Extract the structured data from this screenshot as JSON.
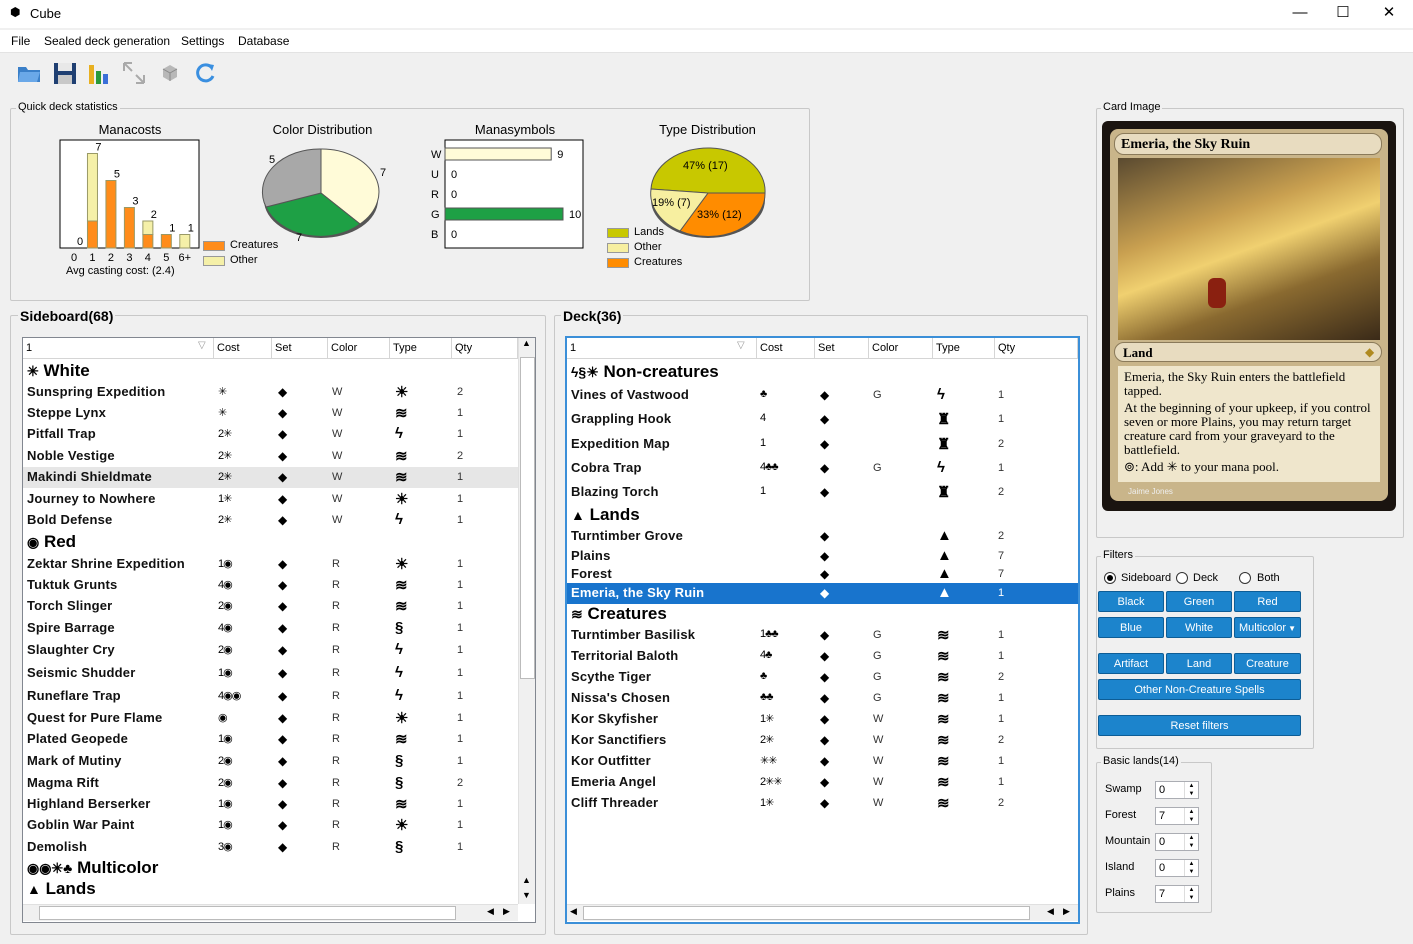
{
  "window": {
    "title": "Cube",
    "minimize": "—",
    "maximize": "☐",
    "close": "✕"
  },
  "menu": [
    "File",
    "Sealed deck generation",
    "Settings",
    "Database"
  ],
  "stats": {
    "group_label": "Quick deck statistics",
    "manacosts_title": "Manacosts",
    "color_title": "Color Distribution",
    "symbols_title": "Manasymbols",
    "type_title": "Type Distribution",
    "avg": "Avg casting cost: (2.4)",
    "legend_creatures": "Creatures",
    "legend_other": "Other",
    "type_legend": [
      "Lands",
      "Other",
      "Creatures"
    ],
    "pie_labels": {
      "color_left": "5",
      "color_right": "7",
      "color_bottom": "7"
    },
    "type_labels": [
      "47% (17)",
      "19% (7)",
      "33% (12)"
    ]
  },
  "chart_data": [
    {
      "type": "bar",
      "title": "Manacosts",
      "categories": [
        "0",
        "1",
        "2",
        "3",
        "4",
        "5",
        "6+"
      ],
      "series": [
        {
          "name": "Creatures",
          "values": [
            0,
            2,
            5,
            3,
            1,
            1,
            0
          ]
        },
        {
          "name": "Other",
          "values": [
            0,
            5,
            0,
            0,
            1,
            0,
            1
          ]
        }
      ],
      "totals": [
        0,
        7,
        5,
        3,
        2,
        1,
        1
      ],
      "ylim": [
        0,
        8
      ]
    },
    {
      "type": "pie",
      "title": "Color Distribution",
      "values": [
        5,
        7,
        7
      ],
      "colors": [
        "#a8a8a8",
        "#fffbd8",
        "#1ea045"
      ]
    },
    {
      "type": "bar",
      "title": "Manasymbols",
      "orientation": "horizontal",
      "categories": [
        "W",
        "U",
        "R",
        "G",
        "B"
      ],
      "values": [
        9,
        0,
        0,
        10,
        0
      ],
      "xlim": [
        0,
        10
      ]
    },
    {
      "type": "pie",
      "title": "Type Distribution",
      "values": [
        17,
        7,
        12
      ],
      "labels": [
        "Lands",
        "Other",
        "Creatures"
      ]
    }
  ],
  "sideboard": {
    "title": "Sideboard(68)",
    "headers": [
      "1",
      "Cost",
      "Set",
      "Color",
      "Type",
      "Qty"
    ],
    "groups": [
      "White",
      "Red",
      "Multicolor",
      "Lands"
    ],
    "rows": [
      {
        "name": "Sunspring Expedition",
        "cost": "✳",
        "color": "W",
        "type": "☀",
        "qty": "2"
      },
      {
        "name": "Steppe Lynx",
        "cost": "✳",
        "color": "W",
        "type": "≋",
        "qty": "1"
      },
      {
        "name": "Pitfall Trap",
        "cost": "2✳",
        "color": "W",
        "type": "ϟ",
        "qty": "1"
      },
      {
        "name": "Noble Vestige",
        "cost": "2✳",
        "color": "W",
        "type": "≋",
        "qty": "2"
      },
      {
        "name": "Makindi Shieldmate",
        "cost": "2✳",
        "color": "W",
        "type": "≋",
        "qty": "1"
      },
      {
        "name": "Journey to Nowhere",
        "cost": "1✳",
        "color": "W",
        "type": "☀",
        "qty": "1"
      },
      {
        "name": "Bold Defense",
        "cost": "2✳",
        "color": "W",
        "type": "ϟ",
        "qty": "1"
      },
      {
        "name": "Zektar Shrine Expedition",
        "cost": "1◉",
        "color": "R",
        "type": "☀",
        "qty": "1"
      },
      {
        "name": "Tuktuk Grunts",
        "cost": "4◉",
        "color": "R",
        "type": "≋",
        "qty": "1"
      },
      {
        "name": "Torch Slinger",
        "cost": "2◉",
        "color": "R",
        "type": "≋",
        "qty": "1"
      },
      {
        "name": "Spire Barrage",
        "cost": "4◉",
        "color": "R",
        "type": "§",
        "qty": "1"
      },
      {
        "name": "Slaughter Cry",
        "cost": "2◉",
        "color": "R",
        "type": "ϟ",
        "qty": "1"
      },
      {
        "name": "Seismic Shudder",
        "cost": "1◉",
        "color": "R",
        "type": "ϟ",
        "qty": "1"
      },
      {
        "name": "Runeflare Trap",
        "cost": "4◉◉",
        "color": "R",
        "type": "ϟ",
        "qty": "1"
      },
      {
        "name": "Quest for Pure Flame",
        "cost": "◉",
        "color": "R",
        "type": "☀",
        "qty": "1"
      },
      {
        "name": "Plated Geopede",
        "cost": "1◉",
        "color": "R",
        "type": "≋",
        "qty": "1"
      },
      {
        "name": "Mark of Mutiny",
        "cost": "2◉",
        "color": "R",
        "type": "§",
        "qty": "1"
      },
      {
        "name": "Magma Rift",
        "cost": "2◉",
        "color": "R",
        "type": "§",
        "qty": "2"
      },
      {
        "name": "Highland Berserker",
        "cost": "1◉",
        "color": "R",
        "type": "≋",
        "qty": "1"
      },
      {
        "name": "Goblin War Paint",
        "cost": "1◉",
        "color": "R",
        "type": "☀",
        "qty": "1"
      },
      {
        "name": "Demolish",
        "cost": "3◉",
        "color": "R",
        "type": "§",
        "qty": "1"
      }
    ]
  },
  "deck": {
    "title": "Deck(36)",
    "headers": [
      "1",
      "Cost",
      "Set",
      "Color",
      "Type",
      "Qty"
    ],
    "groups": [
      "Non-creatures",
      "Lands",
      "Creatures"
    ],
    "rows": [
      {
        "name": "Vines of Vastwood",
        "cost": "♣",
        "color": "G",
        "type": "ϟ",
        "qty": "1"
      },
      {
        "name": "Grappling Hook",
        "cost": "4",
        "color": "",
        "type": "♜",
        "qty": "1"
      },
      {
        "name": "Expedition Map",
        "cost": "1",
        "color": "",
        "type": "♜",
        "qty": "2"
      },
      {
        "name": "Cobra Trap",
        "cost": "4♣♣",
        "color": "G",
        "type": "ϟ",
        "qty": "1"
      },
      {
        "name": "Blazing Torch",
        "cost": "1",
        "color": "",
        "type": "♜",
        "qty": "2"
      },
      {
        "name": "Turntimber Grove",
        "cost": "",
        "color": "",
        "type": "▲",
        "qty": "2"
      },
      {
        "name": "Plains",
        "cost": "",
        "color": "",
        "type": "▲",
        "qty": "7"
      },
      {
        "name": "Forest",
        "cost": "",
        "color": "",
        "type": "▲",
        "qty": "7"
      },
      {
        "name": "Emeria, the Sky Ruin",
        "cost": "",
        "color": "",
        "type": "▲",
        "qty": "1"
      },
      {
        "name": "Turntimber Basilisk",
        "cost": "1♣♣",
        "color": "G",
        "type": "≋",
        "qty": "1"
      },
      {
        "name": "Territorial Baloth",
        "cost": "4♣",
        "color": "G",
        "type": "≋",
        "qty": "1"
      },
      {
        "name": "Scythe Tiger",
        "cost": "♣",
        "color": "G",
        "type": "≋",
        "qty": "2"
      },
      {
        "name": "Nissa's Chosen",
        "cost": "♣♣",
        "color": "G",
        "type": "≋",
        "qty": "1"
      },
      {
        "name": "Kor Skyfisher",
        "cost": "1✳",
        "color": "W",
        "type": "≋",
        "qty": "1"
      },
      {
        "name": "Kor Sanctifiers",
        "cost": "2✳",
        "color": "W",
        "type": "≋",
        "qty": "2"
      },
      {
        "name": "Kor Outfitter",
        "cost": "✳✳",
        "color": "W",
        "type": "≋",
        "qty": "1"
      },
      {
        "name": "Emeria Angel",
        "cost": "2✳✳",
        "color": "W",
        "type": "≋",
        "qty": "1"
      },
      {
        "name": "Cliff Threader",
        "cost": "1✳",
        "color": "W",
        "type": "≋",
        "qty": "2"
      }
    ]
  },
  "card": {
    "group_label": "Card Image",
    "name": "Emeria, the Sky Ruin",
    "type_line": "Land",
    "text1": "Emeria, the Sky Ruin enters the battlefield tapped.",
    "text2": "At the beginning of your upkeep, if you control seven or more Plains, you may return target creature card from your graveyard to the battlefield.",
    "text3": ": Add ✳ to your mana pool.",
    "artist": "Jaime Jones"
  },
  "filters": {
    "group_label": "Filters",
    "radios": [
      "Sideboard",
      "Deck",
      "Both"
    ],
    "buttons1": [
      "Black",
      "Green",
      "Red"
    ],
    "buttons2": [
      "Blue",
      "White",
      "Multicolor"
    ],
    "buttons3": [
      "Artifact",
      "Land",
      "Creature"
    ],
    "other": "Other Non-Creature Spells",
    "reset": "Reset filters"
  },
  "basic": {
    "group_label": "Basic lands(14)",
    "lands": [
      {
        "name": "Swamp",
        "value": "0"
      },
      {
        "name": "Forest",
        "value": "7"
      },
      {
        "name": "Mountain",
        "value": "0"
      },
      {
        "name": "Island",
        "value": "0"
      },
      {
        "name": "Plains",
        "value": "7"
      }
    ]
  }
}
